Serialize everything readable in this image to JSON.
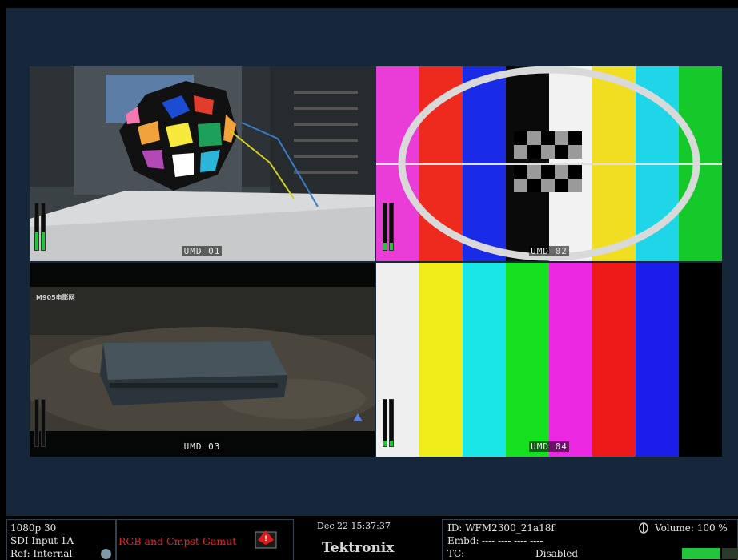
{
  "video_tiles": [
    {
      "label": "UMD 01"
    },
    {
      "label": "UMD 02"
    },
    {
      "label": "UMD 03",
      "watermark": "M905电影网"
    },
    {
      "label": "UMD 04"
    }
  ],
  "status": {
    "format": "1080p 30",
    "input": "SDI Input 1A",
    "reference": "Ref: Internal",
    "alarm": "RGB and Cmpst Gamut",
    "datetime": "Dec 22 15:37:37",
    "brand": "Tektronix",
    "id": "ID: WFM2300_21a18f",
    "embd_label": "Embd:",
    "embd_value": "---- ---- ---- ----",
    "tc_label": "TC:",
    "tc_value": "Disabled",
    "volume": "Volume: 100 %"
  },
  "colors": {
    "background": "#162739",
    "alarm_text": "#e8222b",
    "meter_green": "#21c43a"
  }
}
